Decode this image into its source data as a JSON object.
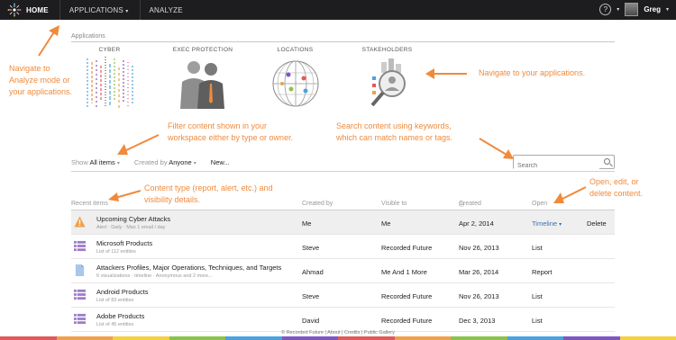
{
  "topbar": {
    "home": "HOME",
    "applications": "APPLICATIONS",
    "analyze": "ANALYZE",
    "help": "?",
    "user": "Greg"
  },
  "apps": {
    "label": "Applications",
    "items": [
      {
        "name": "CYBER"
      },
      {
        "name": "EXEC PROTECTION"
      },
      {
        "name": "LOCATIONS"
      },
      {
        "name": "STAKEHOLDERS"
      }
    ]
  },
  "annotations": {
    "nav": "Navigate to\nAnalyze mode or\nyour applications.",
    "apps": "Navigate to your applications.",
    "filter": "Filter content shown in your\nworkspace either by type or owner.",
    "search": "Search content using keywords,\nwhich can match names or tags.",
    "type": "Content type (report, alert, etc.) and\nvisibility details.",
    "open": "Open, edit, or\ndelete content."
  },
  "filters": {
    "show_label": "Show",
    "show_value": "All items",
    "created_label": "Created by",
    "created_value": "Anyone",
    "new": "New...",
    "search_placeholder": "Search"
  },
  "table": {
    "headers": {
      "items": "Recent items",
      "created_by": "Created by",
      "visible_to": "Visible to",
      "created": "Created",
      "open": "Open"
    },
    "rows": [
      {
        "type": "alert",
        "title": "Upcoming Cyber Attacks",
        "sub": "Alert · Daily · Max 1 email / day",
        "created_by": "Me",
        "visible_to": "Me",
        "created": "Apr 2, 2014",
        "open": "Timeline",
        "action": "Delete"
      },
      {
        "type": "list",
        "title": "Microsoft Products",
        "sub": "List of 112 entities",
        "created_by": "Steve",
        "visible_to": "Recorded Future",
        "created": "Nov 26, 2013",
        "open": "List",
        "action": ""
      },
      {
        "type": "report",
        "title": "Attackers Profiles, Major Operations, Techniques, and Targets",
        "sub": "6 visualizations · timeline · Anonymous and 2 more...",
        "created_by": "Ahmad",
        "visible_to": "Me And 1 More",
        "created": "Mar 26, 2014",
        "open": "Report",
        "action": ""
      },
      {
        "type": "list",
        "title": "Android Products",
        "sub": "List of 83 entities",
        "created_by": "Steve",
        "visible_to": "Recorded Future",
        "created": "Nov 26, 2013",
        "open": "List",
        "action": ""
      },
      {
        "type": "list",
        "title": "Adobe Products",
        "sub": "List of 45 entities",
        "created_by": "David",
        "visible_to": "Recorded Future",
        "created": "Dec 3, 2013",
        "open": "List",
        "action": ""
      }
    ]
  },
  "footer": "© Recorded Future | About | Credits | Public Gallery",
  "colors": {
    "annotation": "#f08a3c",
    "topbar": "#1d1d1f",
    "link": "#3b6fb6",
    "list_icon": "#9c7cc8",
    "alert_icon": "#f0a04b",
    "report_icon": "#a9c6ec"
  }
}
